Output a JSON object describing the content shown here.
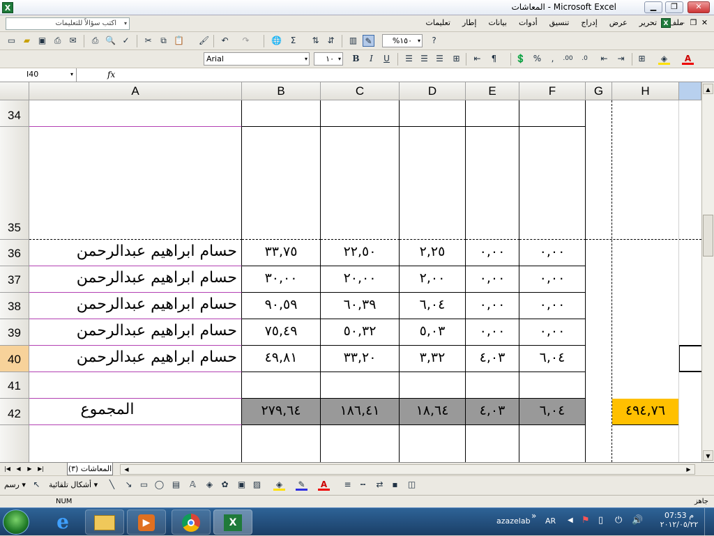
{
  "window": {
    "title": "Microsoft Excel - المعاشات",
    "app_icon": "X"
  },
  "menu": {
    "items": [
      "ملف",
      "تحرير",
      "عرض",
      "إدراج",
      "تنسيق",
      "أدوات",
      "بيانات",
      "إطار",
      "تعليمات"
    ],
    "ask_placeholder": "اكتب سؤالاً للتعليمات"
  },
  "toolbar": {
    "zoom": "%١٥٠",
    "font_name": "Arial",
    "font_size": "١٠",
    "bold": "B",
    "italic": "I",
    "underline": "U",
    "percent": "%",
    "comma": ",",
    "sigma": "Σ"
  },
  "formula_bar": {
    "name_box": "I40",
    "fx": "fx",
    "content": ""
  },
  "columns": [
    "A",
    "B",
    "C",
    "D",
    "E",
    "F",
    "G",
    "H"
  ],
  "rows": [
    {
      "num": "34",
      "name": "",
      "b": "",
      "c": "",
      "d": "",
      "e": "",
      "f": "",
      "h": ""
    },
    {
      "num": "35",
      "name": "",
      "b": "",
      "c": "",
      "d": "",
      "e": "",
      "f": "",
      "h": ""
    },
    {
      "num": "36",
      "name": "حسام ابراهيم عبدالرحمن",
      "b": "٣٣,٧٥",
      "c": "٢٢,٥٠",
      "d": "٢,٢٥",
      "e": "٠,٠٠",
      "f": "٠,٠٠",
      "h": ""
    },
    {
      "num": "37",
      "name": "حسام ابراهيم عبدالرحمن",
      "b": "٣٠,٠٠",
      "c": "٢٠,٠٠",
      "d": "٢,٠٠",
      "e": "٠,٠٠",
      "f": "٠,٠٠",
      "h": ""
    },
    {
      "num": "38",
      "name": "حسام ابراهيم عبدالرحمن",
      "b": "٩٠,٥٩",
      "c": "٦٠,٣٩",
      "d": "٦,٠٤",
      "e": "٠,٠٠",
      "f": "٠,٠٠",
      "h": ""
    },
    {
      "num": "39",
      "name": "حسام ابراهيم عبدالرحمن",
      "b": "٧٥,٤٩",
      "c": "٥٠,٣٢",
      "d": "٥,٠٣",
      "e": "٠,٠٠",
      "f": "٠,٠٠",
      "h": ""
    },
    {
      "num": "40",
      "name": "حسام ابراهيم عبدالرحمن",
      "b": "٤٩,٨١",
      "c": "٣٣,٢٠",
      "d": "٣,٣٢",
      "e": "٤,٠٣",
      "f": "٦,٠٤",
      "h": ""
    },
    {
      "num": "41",
      "name": "",
      "b": "",
      "c": "",
      "d": "",
      "e": "",
      "f": "",
      "h": ""
    },
    {
      "num": "42",
      "name": "المجموع",
      "b": "٢٧٩,٦٤",
      "c": "١٨٦,٤١",
      "d": "١٨,٦٤",
      "e": "٤,٠٣",
      "f": "٦,٠٤",
      "h": "٤٩٤,٧٦"
    }
  ],
  "sheet_tab": "المعاشات (٣)",
  "drawing": {
    "draw_label": "رسم",
    "autoshapes_label": "أشكال تلقائية"
  },
  "status": {
    "ready": "جاهز",
    "num": "NUM"
  },
  "taskbar": {
    "user": "azazelab",
    "lang": "AR",
    "time": "07:53 م",
    "date": "٢٠١٢/٠٥/٢٢"
  },
  "colors": {
    "total_fill": "#999999",
    "grand_total_fill": "#ffc000",
    "row_divider": "#b23fb2",
    "selected_row": "#f7d29a"
  }
}
